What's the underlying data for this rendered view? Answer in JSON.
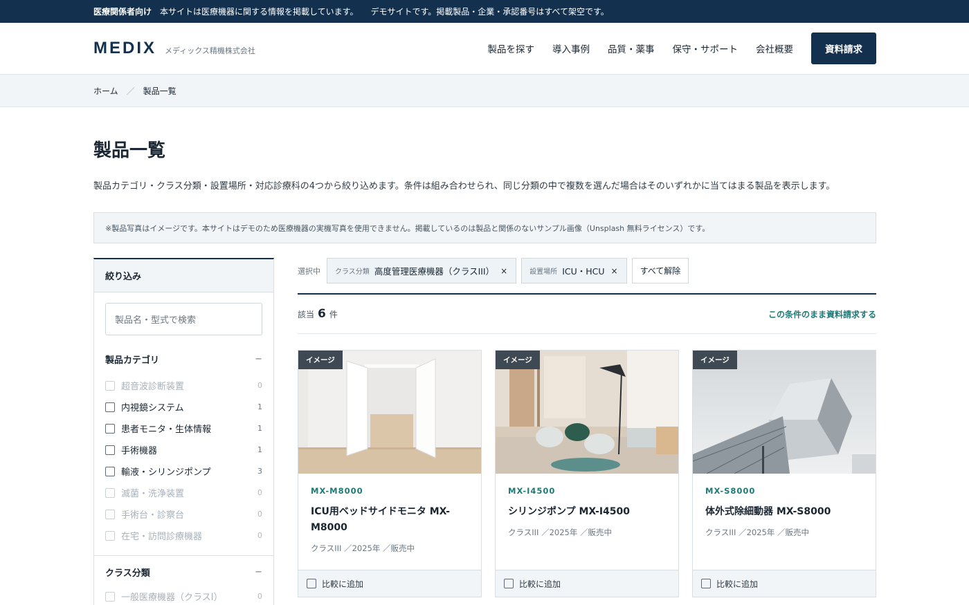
{
  "notice": {
    "label": "医療関係者向け",
    "text1": "本サイトは医療機器に関する情報を掲載しています。",
    "text2": "デモサイトです。掲載製品・企業・承認番号はすべて架空です。"
  },
  "header": {
    "logo": "MEDIX",
    "company": "メディックス精機株式会社",
    "nav": [
      "製品を探す",
      "導入事例",
      "品質・薬事",
      "保守・サポート",
      "会社概要"
    ],
    "cta": "資料請求"
  },
  "breadcrumb": {
    "home": "ホーム",
    "sep": "／",
    "current": "製品一覧"
  },
  "page": {
    "title": "製品一覧",
    "lead": "製品カテゴリ・クラス分類・設置場所・対応診療科の4つから絞り込めます。条件は組み合わせられ、同じ分類の中で複数を選んだ場合はそのいずれかに当てはまる製品を表示します。",
    "photo_note": "※製品写真はイメージです。本サイトはデモのため医療機器の実機写真を使用できません。掲載しているのは製品と関係のないサンプル画像（Unsplash 無料ライセンス）です。"
  },
  "sidebar": {
    "title": "絞り込み",
    "search_placeholder": "製品名・型式で検索",
    "category": {
      "title": "製品カテゴリ",
      "toggle": "−",
      "items": [
        {
          "label": "超音波診断装置",
          "count": "0"
        },
        {
          "label": "内視鏡システム",
          "count": "1"
        },
        {
          "label": "患者モニタ・生体情報",
          "count": "1"
        },
        {
          "label": "手術機器",
          "count": "1"
        },
        {
          "label": "輸液・シリンジポンプ",
          "count": "3"
        },
        {
          "label": "滅菌・洗浄装置",
          "count": "0"
        },
        {
          "label": "手術台・診察台",
          "count": "0"
        },
        {
          "label": "在宅・訪問診療機器",
          "count": "0"
        }
      ]
    },
    "class": {
      "title": "クラス分類",
      "toggle": "−",
      "items": [
        {
          "label": "一般医療機器（クラスI）",
          "count": "0"
        }
      ]
    }
  },
  "filters": {
    "label": "選択中",
    "chips": [
      {
        "key": "クラス分類",
        "value": "高度管理医療機器（クラスIII）",
        "remove": "×"
      },
      {
        "key": "設置場所",
        "value": "ICU・HCU",
        "remove": "×"
      }
    ],
    "clear": "すべて解除"
  },
  "results": {
    "prefix": "該当",
    "count": "6",
    "suffix": "件",
    "request_link": "この条件のまま資料請求する"
  },
  "products": [
    {
      "tag": "イメージ",
      "model": "MX-M8000",
      "name": "ICU用ベッドサイドモニタ MX-M8000",
      "meta": "クラスIII ／2025年 ／販売中",
      "compare": "比較に追加"
    },
    {
      "tag": "イメージ",
      "model": "MX-I4500",
      "name": "シリンジポンプ MX-I4500",
      "meta": "クラスIII ／2025年 ／販売中",
      "compare": "比較に追加"
    },
    {
      "tag": "イメージ",
      "model": "MX-S8000",
      "name": "体外式除細動器 MX-S8000",
      "meta": "クラスIII ／2025年 ／販売中",
      "compare": "比較に追加"
    }
  ],
  "colors": {
    "navy": "#13314f",
    "teal": "#1e7a76",
    "panel": "#f2f5f7"
  }
}
